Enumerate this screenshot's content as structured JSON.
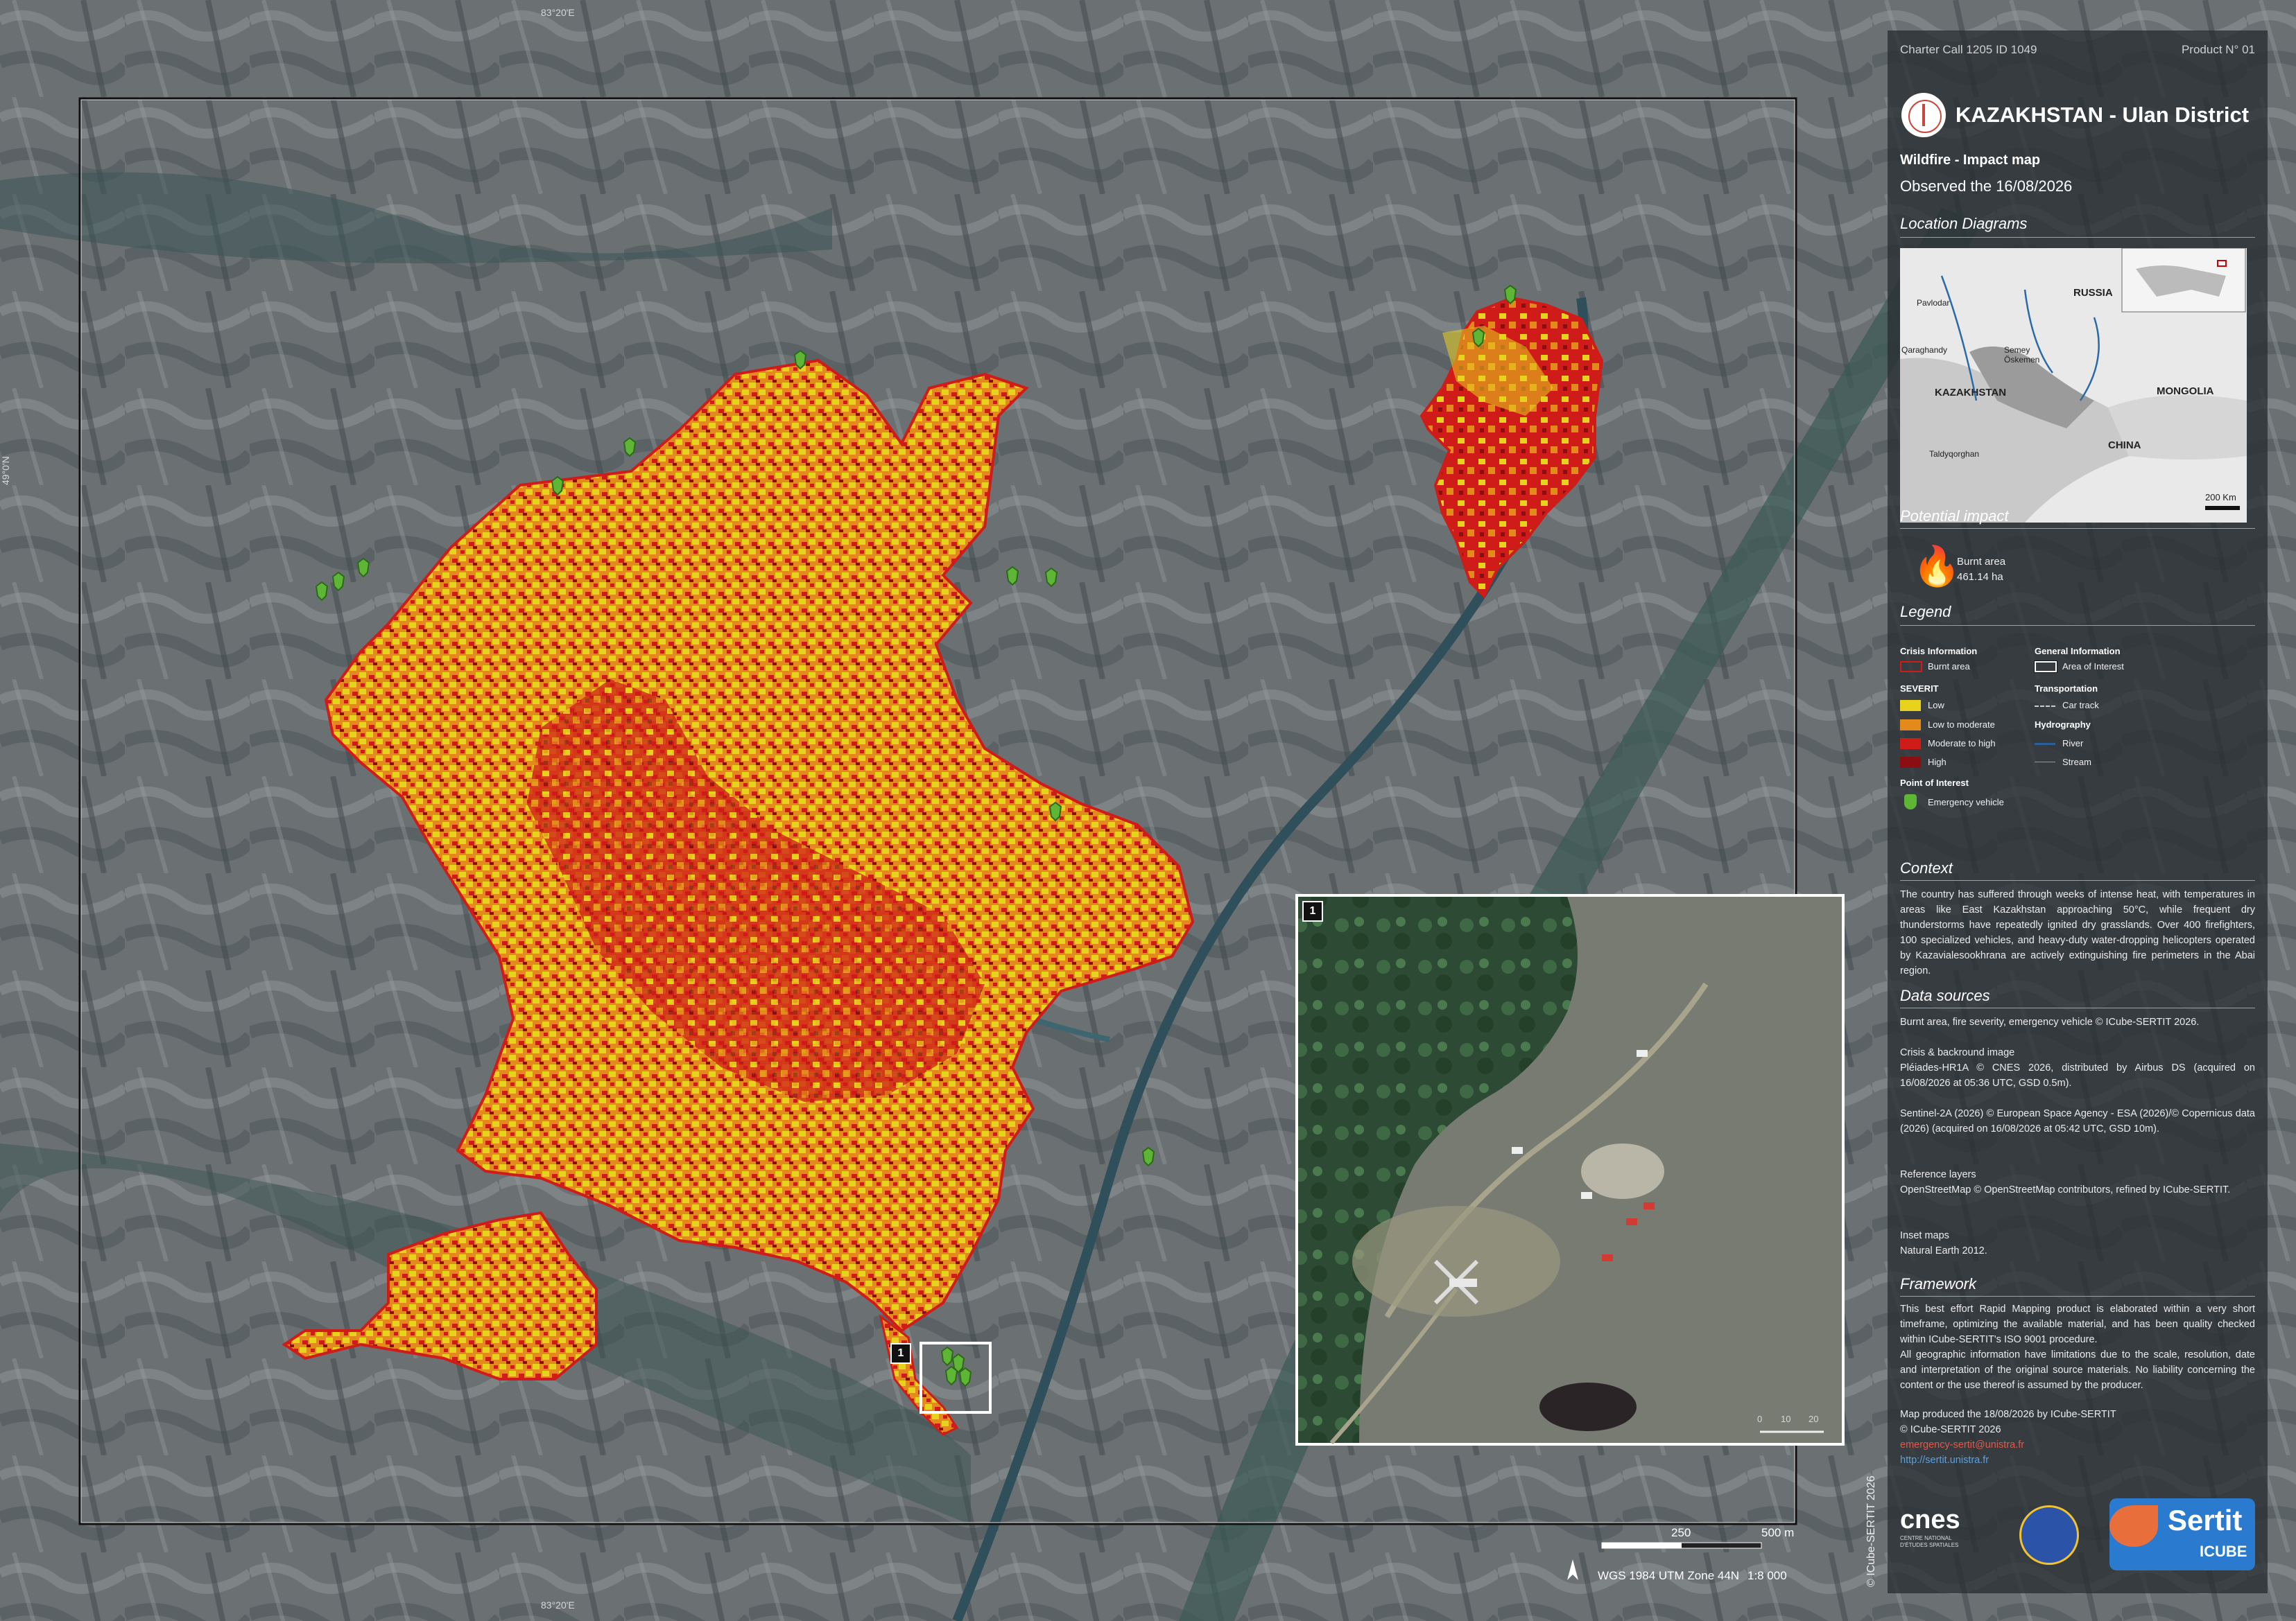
{
  "header": {
    "charter_call": "Charter Call 1205 ID 1049",
    "product": "Product N° 01",
    "title": "KAZAKHSTAN - Ulan District",
    "subtitle": "Wildfire - Impact map",
    "observed": "Observed the 16/08/2026"
  },
  "location": {
    "heading": "Location Diagrams",
    "labels": {
      "russia": "RUSSIA",
      "kazakhstan": "KAZAKHSTAN",
      "mongolia": "MONGOLIA",
      "china": "CHINA",
      "pavlodar": "Pavlodar",
      "qaraghandy": "Qaraghandy",
      "semey": "Semey",
      "oskemen": "Öskemen",
      "taldyqorghan": "Taldyqorghan",
      "scale": "200 Km"
    }
  },
  "impact": {
    "heading": "Potential impact",
    "burnt_label": "Burnt area",
    "burnt_value": "461.14 ha"
  },
  "legend": {
    "heading": "Legend",
    "crisis_info": "Crisis Information",
    "burnt_area": "Burnt area",
    "severity": "SEVERIT",
    "low": "Low",
    "low_moderate": "Low to moderate",
    "moderate_high": "Moderate to high",
    "high": "High",
    "poi": "Point of Interest",
    "emergency_vehicle": "Emergency vehicle",
    "general_info": "General Information",
    "area_of_interest": "Area of Interest",
    "transportation": "Transportation",
    "car_track": "Car track",
    "hydrography": "Hydrography",
    "river": "River",
    "stream": "Stream"
  },
  "context": {
    "heading": "Context",
    "text": "The country has suffered through weeks of intense heat, with temperatures in areas like East Kazakhstan approaching 50°C, while frequent dry thunderstorms have repeatedly ignited dry grasslands. Over 400 firefighters, 100 specialized vehicles, and heavy-duty water-dropping helicopters operated by Kazavialesookhrana are actively extinguishing fire perimeters in the Abai region."
  },
  "sources": {
    "heading": "Data sources",
    "line1": "Burnt area, fire severity, emergency vehicle © ICube-SERTIT 2026.",
    "crisis_title": "Crisis & backround image",
    "crisis_text": "Pléiades-HR1A © CNES 2026, distributed by Airbus DS (acquired on 16/08/2026 at 05:36 UTC, GSD 0.5m).",
    "sentinel_text": "Sentinel-2A (2026) © European Space Agency - ESA (2026)/© Copernicus data (2026) (acquired on 16/08/2026 at 05:42 UTC, GSD 10m).",
    "ref_title": "Reference layers",
    "ref_text": "OpenStreetMap © OpenStreetMap contributors, refined by ICube-SERTIT.",
    "inset_title": "Inset maps",
    "inset_text": "Natural Earth 2012."
  },
  "framework": {
    "heading": "Framework",
    "text1": "This best effort Rapid Mapping product is elaborated within a very short timeframe, optimizing the available material, and has been quality checked within ICube-SERTIT's ISO 9001 procedure.",
    "text2": "All geographic information have limitations due to the scale, resolution, date and interpretation of the original source materials. No liability concerning the content or the use thereof is assumed by the producer.",
    "produced": "Map produced the 18/08/2026 by ICube-SERTIT",
    "copyright": "© ICube-SERTIT 2026",
    "email": "emergency-sertit@unistra.fr",
    "url": "http://sertit.unistra.fr"
  },
  "logos": {
    "cnes": "cnes",
    "cnes_sub": "CENTRE NATIONAL D'ÉTUDES SPATIALES",
    "sertit": "Sertit",
    "icube": "ICUBE"
  },
  "map": {
    "grid_top": "83°20'E",
    "grid_left": "49°0'N",
    "grid_bottom": "83°20'E",
    "scale_250": "250",
    "scale_500": "500 m",
    "projection": "WGS 1984 UTM Zone 44N",
    "ratio": "1:8 000",
    "credit_vertical": "© ICube-SERTIT 2026",
    "inset_marker": "1",
    "inset_scale_0": "0",
    "inset_scale_10": "10",
    "inset_scale_20": "20"
  },
  "colors": {
    "low": "#e7d21e",
    "low_moderate": "#e38a1c",
    "moderate_high": "#cf1c18",
    "high": "#8a0e12",
    "vehicle": "#5fb536",
    "accent": "#c8483a"
  }
}
